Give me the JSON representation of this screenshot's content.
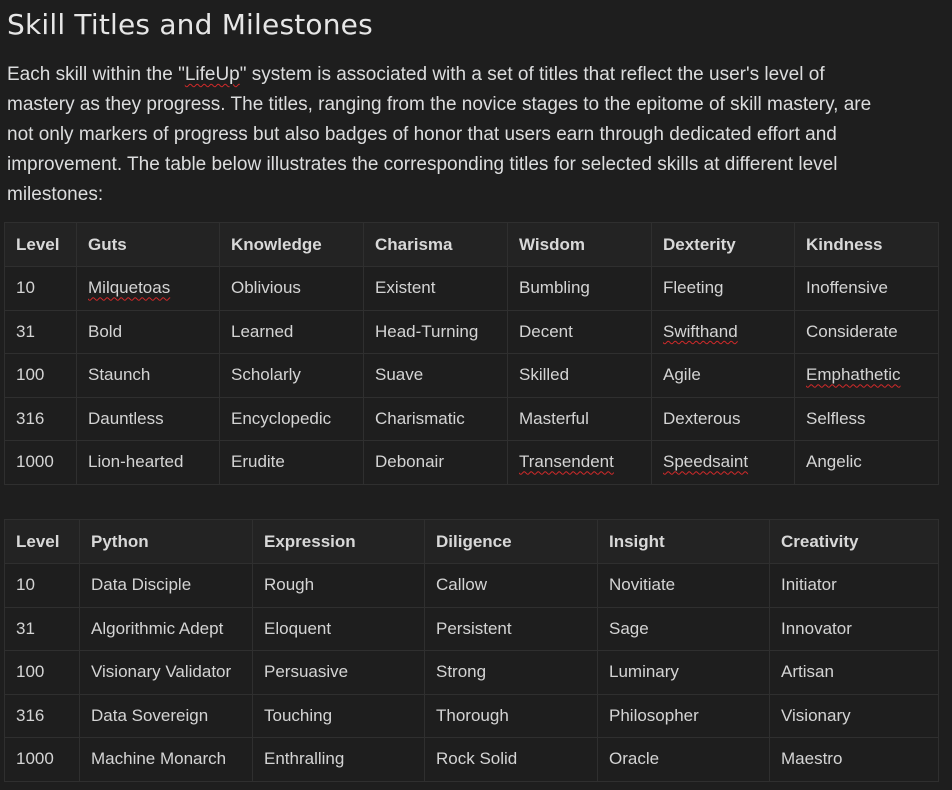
{
  "title": "Skill Titles and Milestones",
  "intro": {
    "before": "Each skill within the \"",
    "highlight": "LifeUp",
    "after": "\" system is associated with a set of titles that reflect the user's level of mastery as they progress. The titles, ranging from the novice stages to the epitome of skill mastery, are not only markers of progress but also badges of honor that users earn through dedicated effort and improvement. The table below illustrates the corresponding titles for selected skills at different level milestones:"
  },
  "tables": [
    {
      "headers": [
        "Level",
        "Guts",
        "Knowledge",
        "Charisma",
        "Wisdom",
        "Dexterity",
        "Kindness"
      ],
      "rows": [
        [
          "10",
          "Milquetoas",
          "Oblivious",
          "Existent",
          "Bumbling",
          "Fleeting",
          "Inoffensive"
        ],
        [
          "31",
          "Bold",
          "Learned",
          "Head-Turning",
          "Decent",
          "Swifthand",
          "Considerate"
        ],
        [
          "100",
          "Staunch",
          "Scholarly",
          "Suave",
          "Skilled",
          "Agile",
          "Emphathetic"
        ],
        [
          "316",
          "Dauntless",
          "Encyclopedic",
          "Charismatic",
          "Masterful",
          "Dexterous",
          "Selfless"
        ],
        [
          "1000",
          "Lion-hearted",
          "Erudite",
          "Debonair",
          "Transendent",
          "Speedsaint",
          "Angelic"
        ]
      ]
    },
    {
      "headers": [
        "Level",
        "Python",
        "Expression",
        "Diligence",
        "Insight",
        "Creativity"
      ],
      "rows": [
        [
          "10",
          "Data Disciple",
          "Rough",
          "Callow",
          "Novitiate",
          "Initiator"
        ],
        [
          "31",
          "Algorithmic Adept",
          "Eloquent",
          "Persistent",
          "Sage",
          "Innovator"
        ],
        [
          "100",
          "Visionary Validator",
          "Persuasive",
          "Strong",
          "Luminary",
          "Artisan"
        ],
        [
          "316",
          "Data Sovereign",
          "Touching",
          "Thorough",
          "Philosopher",
          "Visionary"
        ],
        [
          "1000",
          "Machine Monarch",
          "Enthralling",
          "Rock Solid",
          "Oracle",
          "Maestro"
        ]
      ]
    }
  ]
}
